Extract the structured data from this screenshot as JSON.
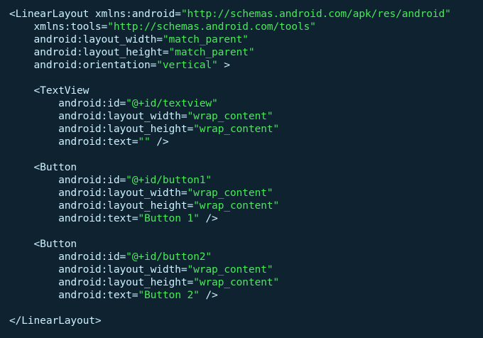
{
  "editor": {
    "colors": {
      "background": "#0f2230",
      "text": "#ccf0ff",
      "string": "#49e85b"
    },
    "lines": [
      [
        {
          "t": "p",
          "v": "<LinearLayout xmlns:android="
        },
        {
          "t": "s",
          "v": "\"http://schemas.android.com/apk/res/android\""
        }
      ],
      [
        {
          "t": "p",
          "v": "    xmlns:tools="
        },
        {
          "t": "s",
          "v": "\"http://schemas.android.com/tools\""
        }
      ],
      [
        {
          "t": "p",
          "v": "    android:layout_width="
        },
        {
          "t": "s",
          "v": "\"match_parent\""
        }
      ],
      [
        {
          "t": "p",
          "v": "    android:layout_height="
        },
        {
          "t": "s",
          "v": "\"match_parent\""
        }
      ],
      [
        {
          "t": "p",
          "v": "    android:orientation="
        },
        {
          "t": "s",
          "v": "\"vertical\""
        },
        {
          "t": "p",
          "v": " >"
        }
      ],
      [],
      [
        {
          "t": "p",
          "v": "    <TextView"
        }
      ],
      [
        {
          "t": "p",
          "v": "        android:id="
        },
        {
          "t": "s",
          "v": "\"@+id/textview\""
        }
      ],
      [
        {
          "t": "p",
          "v": "        android:layout_width="
        },
        {
          "t": "s",
          "v": "\"wrap_content\""
        }
      ],
      [
        {
          "t": "p",
          "v": "        android:layout_height="
        },
        {
          "t": "s",
          "v": "\"wrap_content\""
        }
      ],
      [
        {
          "t": "p",
          "v": "        android:text="
        },
        {
          "t": "s",
          "v": "\"\""
        },
        {
          "t": "p",
          "v": " />"
        }
      ],
      [],
      [
        {
          "t": "p",
          "v": "    <Button"
        }
      ],
      [
        {
          "t": "p",
          "v": "        android:id="
        },
        {
          "t": "s",
          "v": "\"@+id/button1\""
        }
      ],
      [
        {
          "t": "p",
          "v": "        android:layout_width="
        },
        {
          "t": "s",
          "v": "\"wrap_content\""
        }
      ],
      [
        {
          "t": "p",
          "v": "        android:layout_height="
        },
        {
          "t": "s",
          "v": "\"wrap_content\""
        }
      ],
      [
        {
          "t": "p",
          "v": "        android:text="
        },
        {
          "t": "s",
          "v": "\"Button 1\""
        },
        {
          "t": "p",
          "v": " />"
        }
      ],
      [],
      [
        {
          "t": "p",
          "v": "    <Button"
        }
      ],
      [
        {
          "t": "p",
          "v": "        android:id="
        },
        {
          "t": "s",
          "v": "\"@+id/button2\""
        }
      ],
      [
        {
          "t": "p",
          "v": "        android:layout_width="
        },
        {
          "t": "s",
          "v": "\"wrap_content\""
        }
      ],
      [
        {
          "t": "p",
          "v": "        android:layout_height="
        },
        {
          "t": "s",
          "v": "\"wrap_content\""
        }
      ],
      [
        {
          "t": "p",
          "v": "        android:text="
        },
        {
          "t": "s",
          "v": "\"Button 2\""
        },
        {
          "t": "p",
          "v": " />"
        }
      ],
      [],
      [
        {
          "t": "p",
          "v": "</LinearLayout>"
        }
      ]
    ]
  }
}
